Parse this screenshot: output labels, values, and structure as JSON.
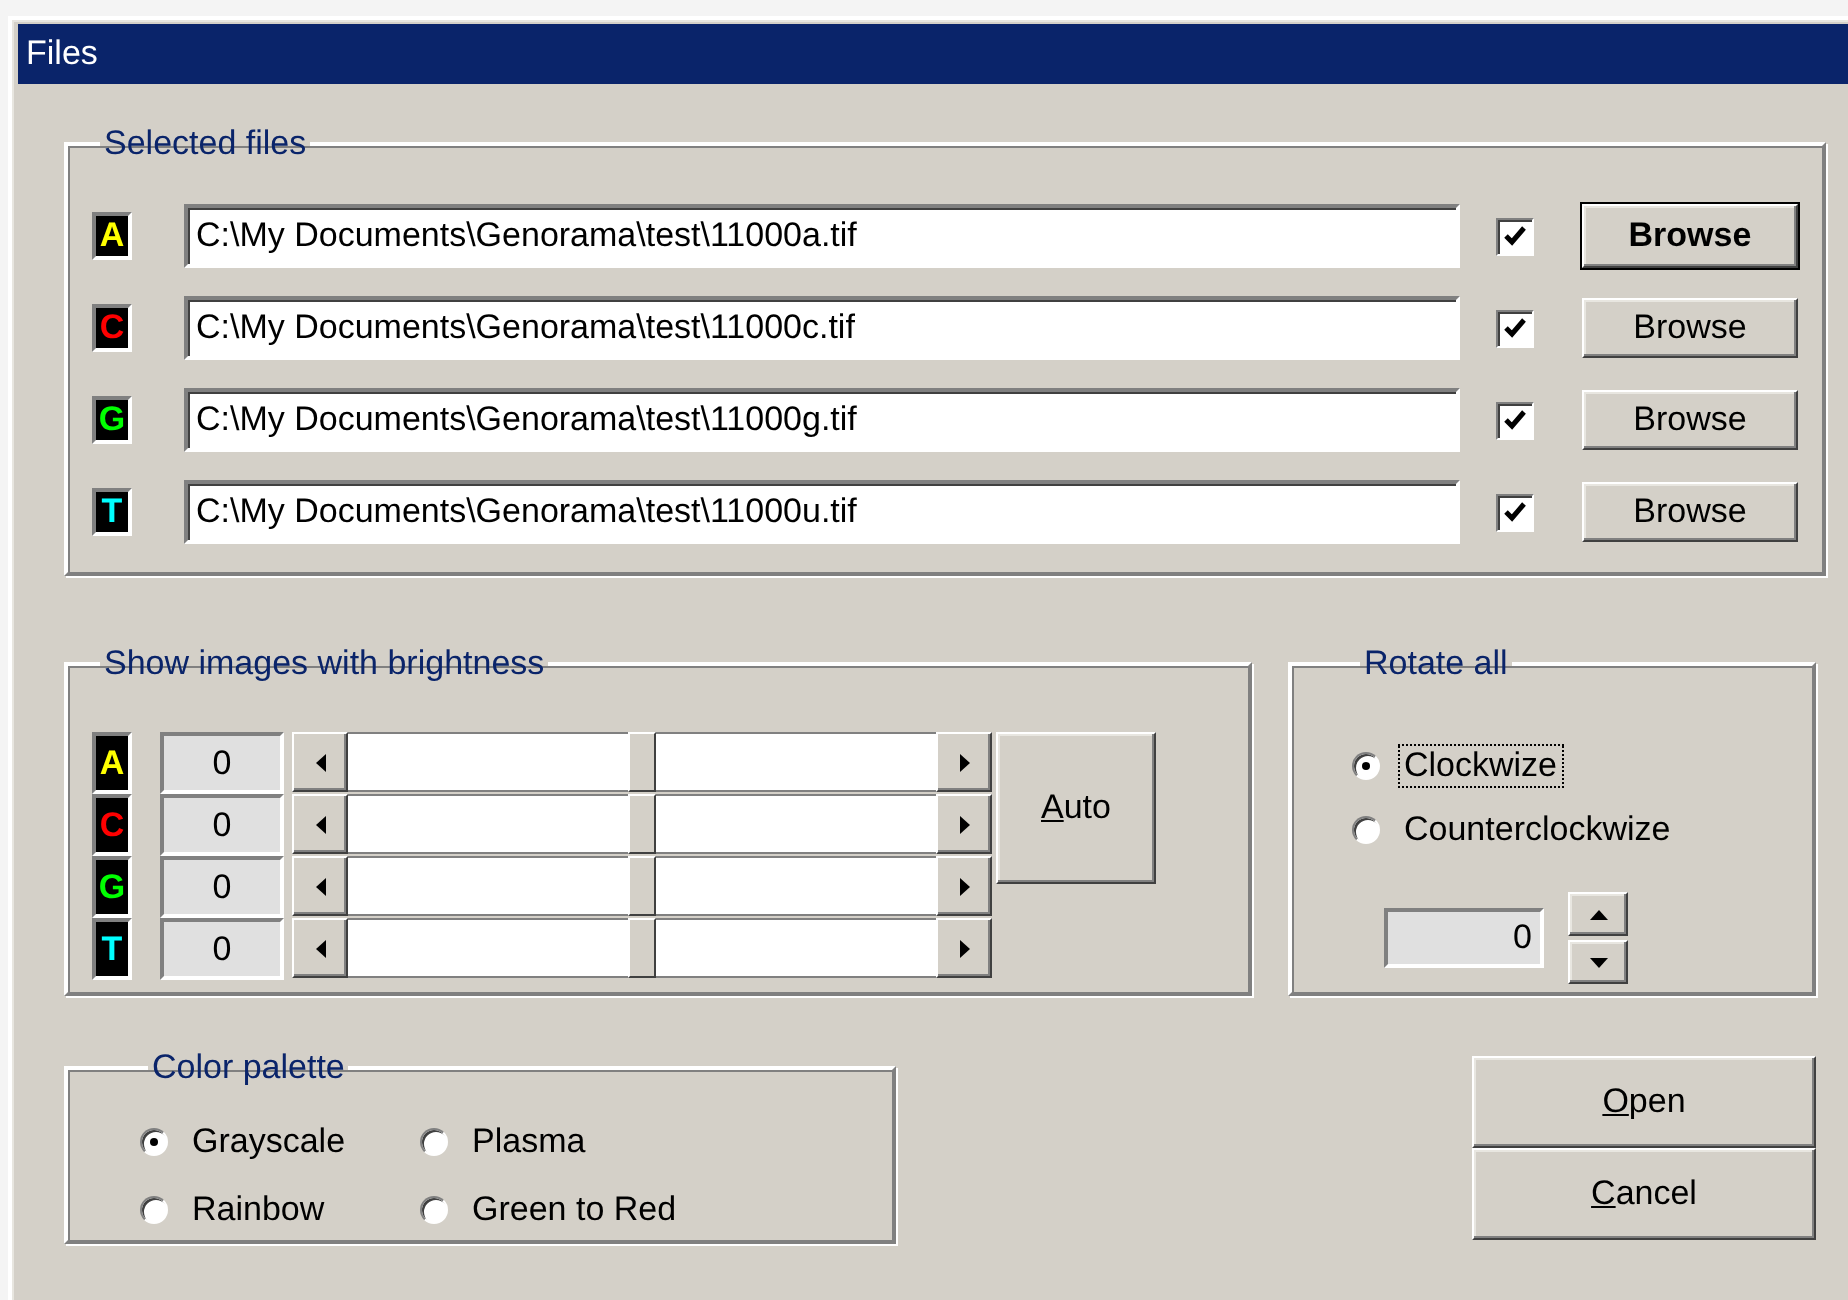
{
  "window": {
    "title": "Files"
  },
  "selected_files": {
    "title": "Selected files",
    "rows": [
      {
        "letter": "A",
        "color": "#ffff00",
        "path": "C:\\My Documents\\Genorama\\test\\11000a.tif",
        "checked": true,
        "button": "Browse",
        "default": true
      },
      {
        "letter": "C",
        "color": "#ff0000",
        "path": "C:\\My Documents\\Genorama\\test\\11000c.tif",
        "checked": true,
        "button": "Browse",
        "default": false
      },
      {
        "letter": "G",
        "color": "#00ff00",
        "path": "C:\\My Documents\\Genorama\\test\\11000g.tif",
        "checked": true,
        "button": "Browse",
        "default": false
      },
      {
        "letter": "T",
        "color": "#00ffff",
        "path": "C:\\My Documents\\Genorama\\test\\11000u.tif",
        "checked": true,
        "button": "Browse",
        "default": false
      }
    ]
  },
  "brightness": {
    "title": "Show images with brightness",
    "rows": [
      {
        "letter": "A",
        "color": "#ffff00",
        "value": "0",
        "level": 0.5
      },
      {
        "letter": "C",
        "color": "#ff0000",
        "value": "0",
        "level": 0.5
      },
      {
        "letter": "G",
        "color": "#00ff00",
        "value": "0",
        "level": 0.5
      },
      {
        "letter": "T",
        "color": "#00ffff",
        "value": "0",
        "level": 0.5
      }
    ],
    "auto_button": {
      "label": "Auto",
      "underline_first": true
    }
  },
  "rotate": {
    "title": "Rotate all",
    "options": [
      {
        "label": "Clockwize",
        "selected": true,
        "focused": true
      },
      {
        "label": "Counterclockwize",
        "selected": false,
        "focused": false
      }
    ],
    "angle": "0"
  },
  "palette": {
    "title": "Color palette",
    "options": [
      {
        "label": "Grayscale",
        "selected": true
      },
      {
        "label": "Plasma",
        "selected": false
      },
      {
        "label": "Rainbow",
        "selected": false
      },
      {
        "label": "Green to Red",
        "selected": false
      }
    ]
  },
  "buttons": [
    {
      "label": "Open",
      "underline_first": true
    },
    {
      "label": "Cancel",
      "underline_first": true
    }
  ]
}
